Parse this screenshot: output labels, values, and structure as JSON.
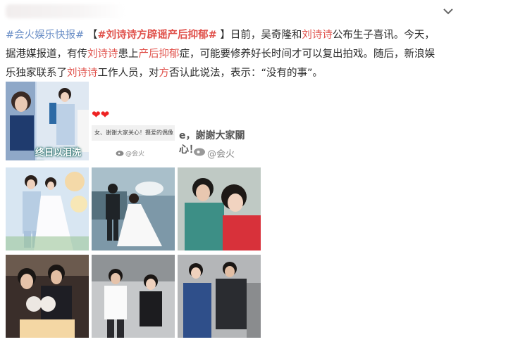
{
  "post": {
    "segments": [
      {
        "text": "#会火娱乐快报#",
        "style": "tag"
      },
      {
        "text": " 【",
        "style": "plain"
      },
      {
        "text": "#刘诗诗方辟谣产后抑郁#",
        "style": "topic"
      },
      {
        "text": " 】日前，吴奇隆和",
        "style": "plain"
      },
      {
        "text": "刘诗诗",
        "style": "hl"
      },
      {
        "text": "公布生子喜讯。今天，据港媒报道，有传",
        "style": "plain"
      },
      {
        "text": "刘诗诗",
        "style": "hl"
      },
      {
        "text": "患上",
        "style": "plain"
      },
      {
        "text": "产后抑郁",
        "style": "hl"
      },
      {
        "text": "症，可能要修养好长时间才可以复出拍戏。随后，新浪娱乐独家联系了",
        "style": "plain"
      },
      {
        "text": "刘诗诗",
        "style": "hl"
      },
      {
        "text": "工作人员，对",
        "style": "plain"
      },
      {
        "text": "方",
        "style": "hl"
      },
      {
        "text": "否认此说法，表示：“没有的事”。",
        "style": "plain"
      }
    ]
  },
  "images": {
    "caption_overlay": "终日以泪洗面",
    "note_strip_text": "女、谢谢大家关心！摄爱的偶像",
    "thanks_banner": "e，謝謝大家關心！",
    "watermark": "@会火",
    "watermark_small": "@会火"
  },
  "colors": {
    "tag": "#6b8fc7",
    "highlight": "#e0504a",
    "text": "#2a2a2a"
  },
  "icons": {
    "collapse": "chevron-down-icon",
    "heart": "heart-icon",
    "weibo": "weibo-logo-icon"
  }
}
